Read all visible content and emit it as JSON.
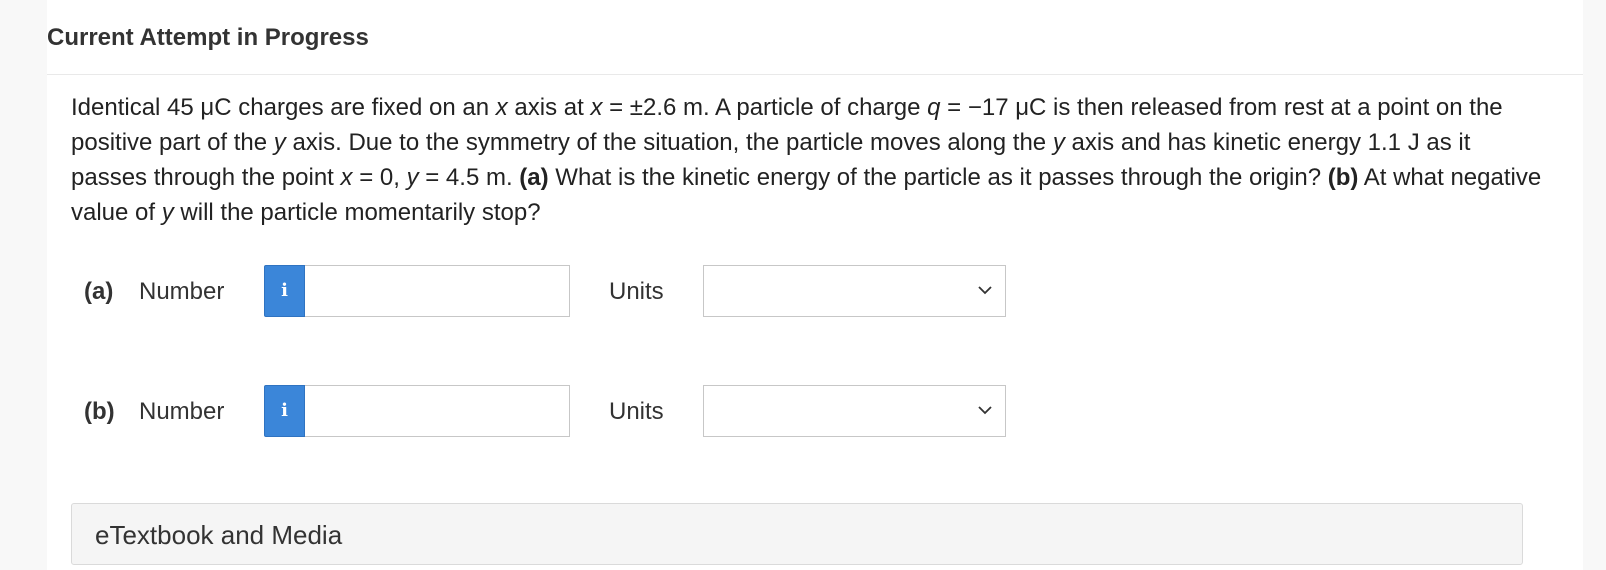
{
  "header": {
    "title": "Current Attempt in Progress"
  },
  "question": {
    "text_1": "Identical 45 μC charges are fixed on an ",
    "var_x1": "x",
    "text_2": " axis at ",
    "var_x2": "x",
    "text_3": " = ±2.6 m. A particle of charge ",
    "var_q": "q",
    "text_4": " = −17 μC is then released from rest at a point on the positive part of the ",
    "var_y1": "y",
    "text_5": " axis. Due to the symmetry of the situation, the particle moves along the ",
    "var_y2": "y",
    "text_6": " axis and has kinetic energy 1.1 J as it passes through the point ",
    "var_x3": "x",
    "text_7": " = 0, ",
    "var_y3": "y",
    "text_8": " = 4.5 m. ",
    "part_a_marker": "(a)",
    "text_9": " What is the kinetic energy of the particle as it passes through the origin? ",
    "part_b_marker": "(b)",
    "text_10": " At what negative value of ",
    "var_y4": "y",
    "text_11": " will the particle momentarily stop?"
  },
  "answers": [
    {
      "part": "(a)",
      "number_label": "Number",
      "info_icon": "i",
      "value": "",
      "units_label": "Units",
      "units_selected": ""
    },
    {
      "part": "(b)",
      "number_label": "Number",
      "info_icon": "i",
      "value": "",
      "units_label": "Units",
      "units_selected": ""
    }
  ],
  "etextbook": {
    "label": "eTextbook and Media"
  },
  "colors": {
    "info_button": "#3b86d9",
    "page_background": "#f8f8f8",
    "panel_background": "#ffffff"
  }
}
